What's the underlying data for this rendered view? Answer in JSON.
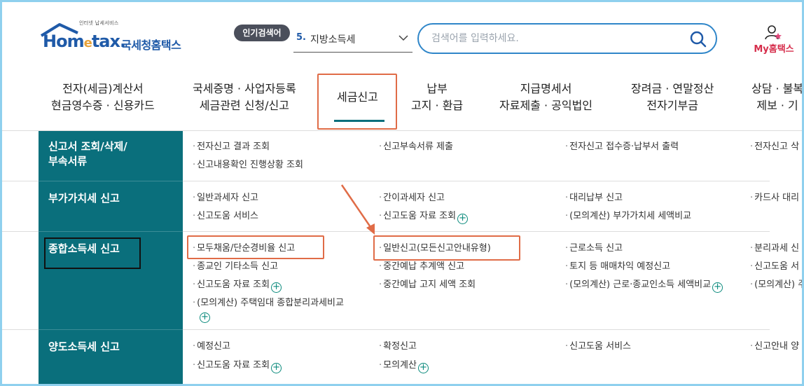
{
  "header": {
    "logo_tagline": "인터넷 납세서비스",
    "logo_word_pre": "Hom",
    "logo_word_e": "e",
    "logo_word_post": "tax.",
    "logo_korean": "국세청홈택스",
    "popular_label": "인기검색어",
    "popular_rank": "5.",
    "popular_term": "지방소득세",
    "search_placeholder": "검색어를 입력하세요.",
    "mytax_label": "My홈택스"
  },
  "gnb": {
    "items": [
      {
        "line1": "전자(세금)계산서",
        "line2": "현금영수증 · 신용카드"
      },
      {
        "line1": "국세증명 · 사업자등록",
        "line2": "세금관련 신청/신고"
      },
      {
        "line1": "세금신고",
        "line2": ""
      },
      {
        "line1": "납부",
        "line2": "고지 · 환급"
      },
      {
        "line1": "지급명세서",
        "line2": "자료제출 · 공익법인"
      },
      {
        "line1": "장려금 · 연말정산",
        "line2": "전자기부금"
      },
      {
        "line1": "상담 · 불복",
        "line2": "제보 · 기"
      }
    ],
    "active_index": 2
  },
  "rows": [
    {
      "title_line1": "신고서 조회/삭제/",
      "title_line2": "부속서류",
      "cells": [
        "전자신고 결과 조회",
        "신고부속서류 제출",
        "전자신고 접수증·납부서 출력",
        "전자신고 삭",
        "신고내용확인 진행상황 조회"
      ]
    },
    {
      "title_line1": "부가가치세 신고",
      "cells": [
        "일반과세자 신고",
        "간이과세자 신고",
        "대리납부 신고",
        "카드사 대리",
        "신고도움 서비스",
        "신고도움 자료 조회",
        "(모의계산) 부가가치세 세액비교"
      ]
    },
    {
      "title_line1": "종합소득세 신고",
      "cells": [
        "모두채움/단순경비율 신고",
        "일반신고(모든신고안내유형)",
        "근로소득 신고",
        "분리과세 신",
        "종교인 기타소득 신고",
        "중간예납 추계액 신고",
        "토지 등 매매차익 예정신고",
        "신고도움 서",
        "신고도움 자료 조회",
        "중간예납 고지 세액 조회",
        "(모의계산) 근로·종교인소득 세액비교",
        "(모의계산) 주",
        "(모의계산) 주택임대 종합분리과세비교"
      ]
    },
    {
      "title_line1": "양도소득세 신고",
      "cells": [
        "예정신고",
        "확정신고",
        "신고도움 서비스",
        "신고안내 양",
        "신고도움 자료 조회",
        "모의계산"
      ]
    }
  ],
  "colors": {
    "brand_blue": "#1f5aa8",
    "teal": "#0a6f7c",
    "highlight": "#e06c47",
    "search_border": "#2f86c9",
    "mytax_red": "#d62d4b"
  }
}
